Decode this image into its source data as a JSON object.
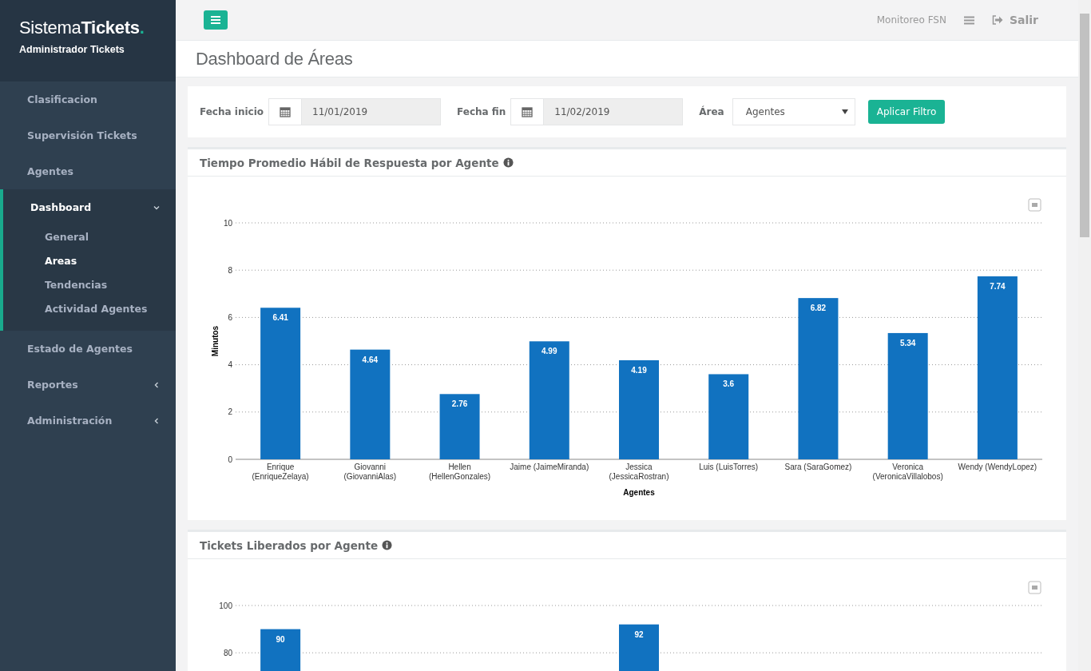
{
  "brand": {
    "name_light": "Sistema",
    "name_bold": "Tickets",
    "dot": ".",
    "subtitle": "Administrador Tickets"
  },
  "sidebar": {
    "items": [
      {
        "label": "Clasificacion",
        "selected": false
      },
      {
        "label": "Supervisión Tickets",
        "selected": false
      },
      {
        "label": "Agentes",
        "selected": false
      },
      {
        "label": "Dashboard",
        "selected": true,
        "expanded": true,
        "children": [
          {
            "label": "General",
            "selected": false
          },
          {
            "label": "Areas",
            "selected": true
          },
          {
            "label": "Tendencias",
            "selected": false
          },
          {
            "label": "Actividad Agentes",
            "selected": false
          }
        ]
      },
      {
        "label": "Estado de Agentes",
        "selected": false
      },
      {
        "label": "Reportes",
        "selected": false,
        "expanded": false
      },
      {
        "label": "Administración",
        "selected": false,
        "expanded": false
      }
    ]
  },
  "topbar": {
    "user": "Monitoreo FSN",
    "logout": "Salir"
  },
  "page_title": "Dashboard de Áreas",
  "filters": {
    "start_label": "Fecha inicio",
    "start_value": "11/01/2019",
    "end_label": "Fecha fin",
    "end_value": "11/02/2019",
    "area_label": "Área",
    "area_value": "Agentes",
    "apply": "Aplicar Filtro"
  },
  "panels": [
    {
      "title": "Tiempo Promedio Hábil de Respuesta por Agente",
      "chart_data": {
        "type": "bar",
        "xlabel": "Agentes",
        "ylabel": "Minutos",
        "categories": [
          "Enrique (EnriqueZelaya)",
          "Giovanni (GiovanniAlas)",
          "Hellen (HellenGonzales)",
          "Jaime (JaimeMiranda)",
          "Jessica (JessicaRostran)",
          "Luis (LuisTorres)",
          "Sara (SaraGomez)",
          "Veronica (VeronicaVillalobos)",
          "Wendy (WendyLopez)"
        ],
        "series": [
          {
            "color": "#1172c0",
            "values": [
              6.41,
              4.64,
              2.76,
              4.99,
              4.19,
              3.6,
              6.82,
              5.34,
              7.74
            ]
          }
        ],
        "ylim": [
          0,
          10
        ],
        "yticks": [
          0,
          2,
          4,
          6,
          8,
          10
        ],
        "grid": true,
        "data_labels": true
      }
    },
    {
      "title": "Tickets Liberados por Agente",
      "chart_data": {
        "type": "bar",
        "series": [
          {
            "color": "#1172c0",
            "values": [
              90,
              null,
              null,
              null,
              92,
              null,
              null,
              null,
              null
            ]
          }
        ],
        "ylim": [
          0,
          100
        ],
        "yticks": [
          80,
          100
        ],
        "grid": true,
        "data_labels": true
      }
    }
  ]
}
